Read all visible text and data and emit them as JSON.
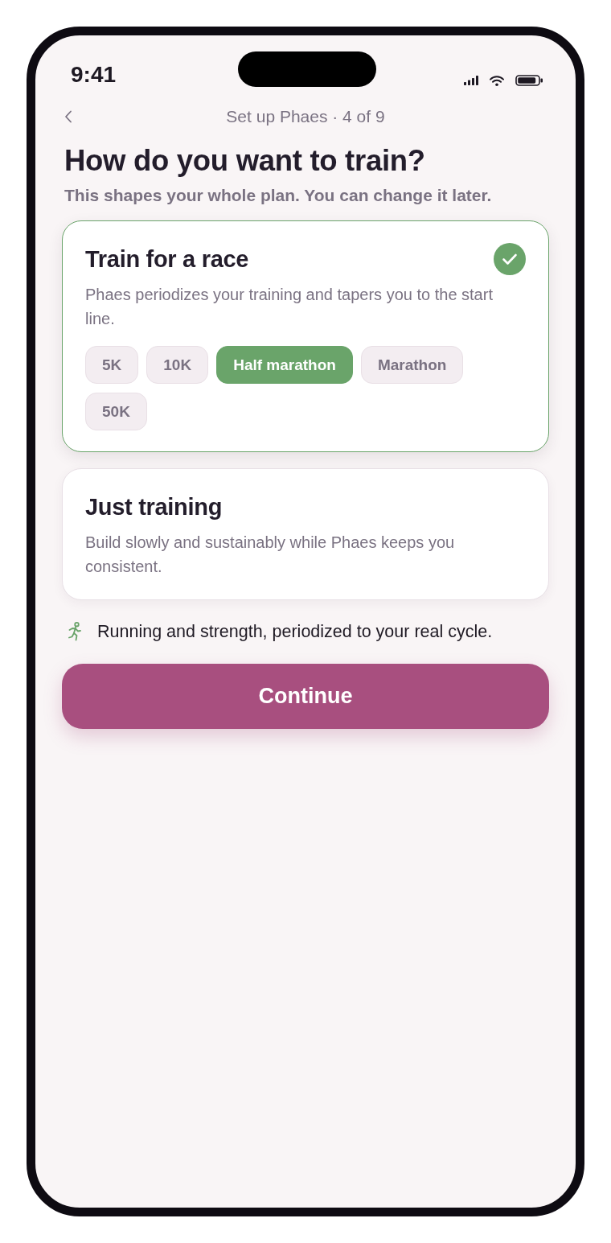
{
  "status_bar": {
    "time": "9:41"
  },
  "header": {
    "title": "Set up Phaes · 4 of 9"
  },
  "heading": "How do you want to train?",
  "subtitle": "This shapes your whole plan. You can change it later.",
  "options": [
    {
      "title": "Train for a race",
      "description": "Phaes periodizes your training and tapers you to the start line.",
      "selected": true,
      "distances": [
        {
          "label": "5K",
          "selected": false
        },
        {
          "label": "10K",
          "selected": false
        },
        {
          "label": "Half marathon",
          "selected": true
        },
        {
          "label": "Marathon",
          "selected": false
        },
        {
          "label": "50K",
          "selected": false
        }
      ]
    },
    {
      "title": "Just training",
      "description": "Build slowly and sustainably while Phaes keeps you consistent.",
      "selected": false
    }
  ],
  "note": "Running and strength, periodized to your real cycle.",
  "primary_button": {
    "label": "Continue"
  }
}
